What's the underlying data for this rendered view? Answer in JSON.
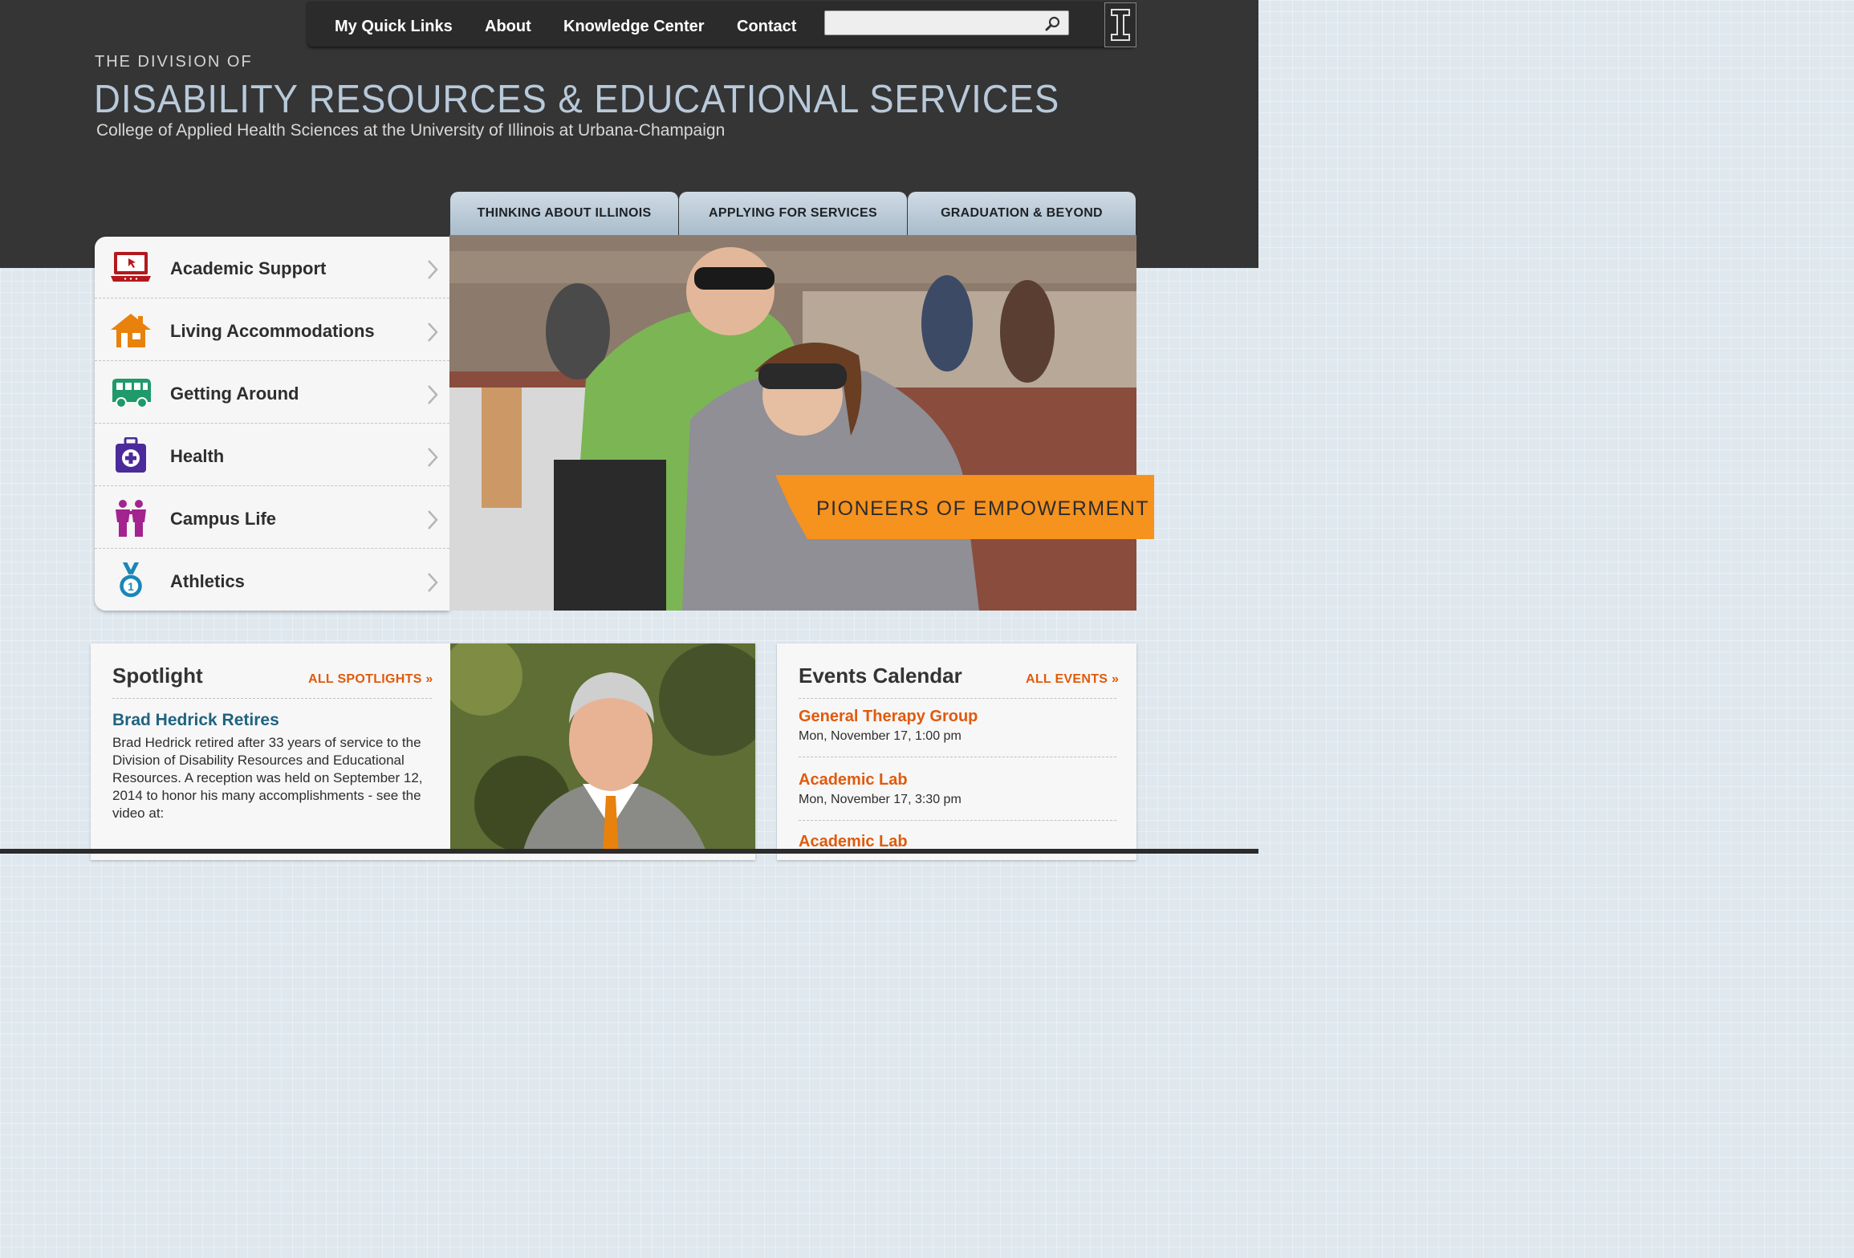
{
  "nav": {
    "items": [
      "My Quick Links",
      "About",
      "Knowledge Center",
      "Contact"
    ],
    "search_placeholder": ""
  },
  "header": {
    "pretitle": "THE DIVISION OF",
    "title": "DISABILITY RESOURCES & EDUCATIONAL SERVICES",
    "subtitle": "College of Applied Health Sciences at the University of Illinois at Urbana-Champaign"
  },
  "tabs": [
    "THINKING ABOUT ILLINOIS",
    "APPLYING FOR SERVICES",
    "GRADUATION & BEYOND"
  ],
  "menu": [
    {
      "label": "Academic Support",
      "icon": "laptop-icon",
      "color": "#b3191c"
    },
    {
      "label": "Living Accommodations",
      "icon": "house-icon",
      "color": "#e8820c"
    },
    {
      "label": "Getting Around",
      "icon": "bus-icon",
      "color": "#1f9a6a"
    },
    {
      "label": "Health",
      "icon": "first-aid-kit-icon",
      "color": "#4b2a9a"
    },
    {
      "label": "Campus Life",
      "icon": "people-icon",
      "color": "#a3238f"
    },
    {
      "label": "Athletics",
      "icon": "medal-icon",
      "color": "#1a86b8"
    }
  ],
  "hero": {
    "banner": "PIONEERS OF EMPOWERMENT",
    "banner_color": "#f6921e"
  },
  "spotlight": {
    "title": "Spotlight",
    "all_link": "ALL SPOTLIGHTS »",
    "headline": "Brad Hedrick Retires",
    "body": "Brad Hedrick retired after 33 years of service to the Division of Disability Resources and Educational Resources. A reception was held on September 12, 2014 to honor his many accomplishments - see the video at:"
  },
  "events": {
    "title": "Events Calendar",
    "all_link": "ALL EVENTS »",
    "items": [
      {
        "title": "General Therapy Group",
        "date": "Mon, November 17, 1:00 pm"
      },
      {
        "title": "Academic Lab",
        "date": "Mon, November 17, 3:30 pm"
      },
      {
        "title": "Academic Lab",
        "date": ""
      }
    ]
  },
  "colors": {
    "header_bg": "#353535",
    "accent": "#e05a0c",
    "link": "#1f6380"
  }
}
